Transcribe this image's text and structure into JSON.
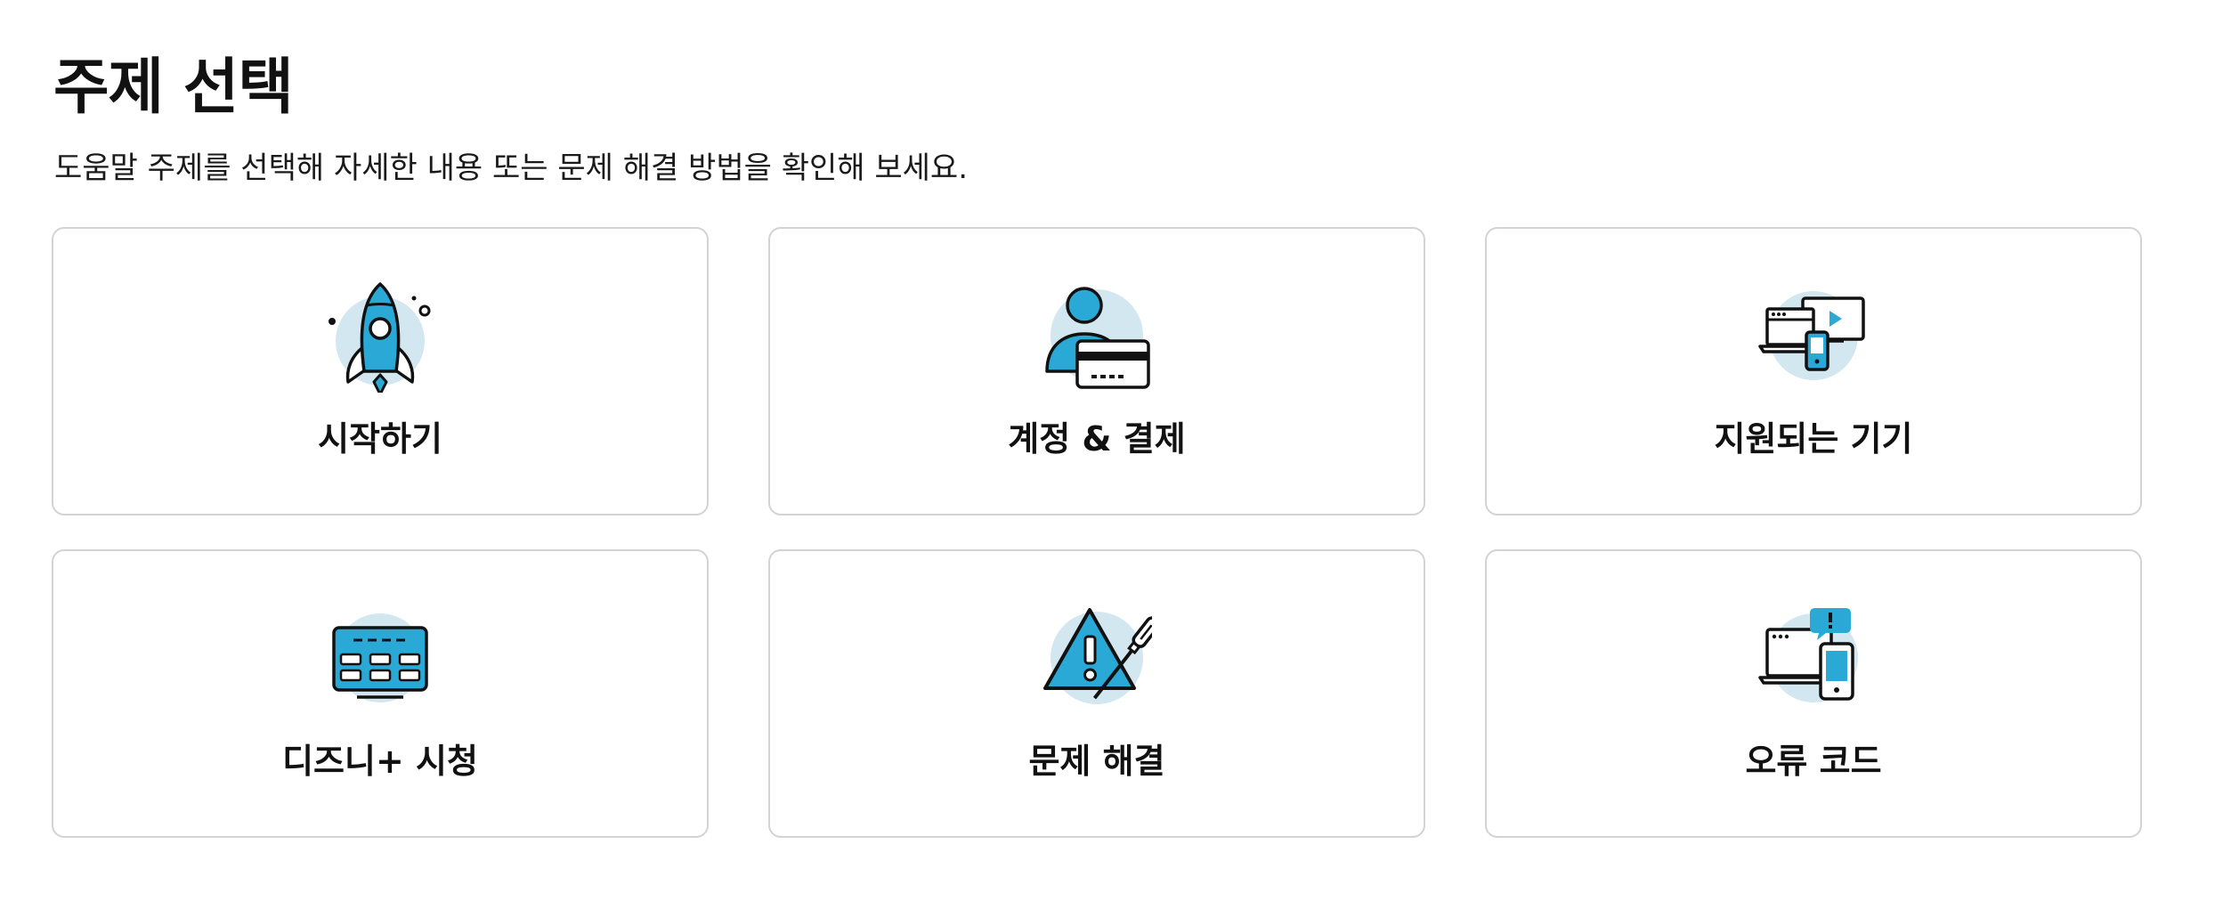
{
  "header": {
    "title": "주제 선택",
    "subtitle": "도움말 주제를 선택해 자세한 내용 또는 문제 해결 방법을 확인해 보세요."
  },
  "colors": {
    "accent": "#2aa8d6",
    "icon_circle": "#d3e7f1",
    "outline": "#111111",
    "card_border": "#d3d3d3"
  },
  "topics": [
    {
      "label": "시작하기",
      "icon": "rocket-icon"
    },
    {
      "label": "계정 & 결제",
      "icon": "account-billing-icon"
    },
    {
      "label": "지원되는 기기",
      "icon": "devices-icon"
    },
    {
      "label": "디즈니+ 시청",
      "icon": "tv-guide-icon"
    },
    {
      "label": "문제 해결",
      "icon": "warning-screwdriver-icon"
    },
    {
      "label": "오류 코드",
      "icon": "error-devices-icon"
    }
  ]
}
